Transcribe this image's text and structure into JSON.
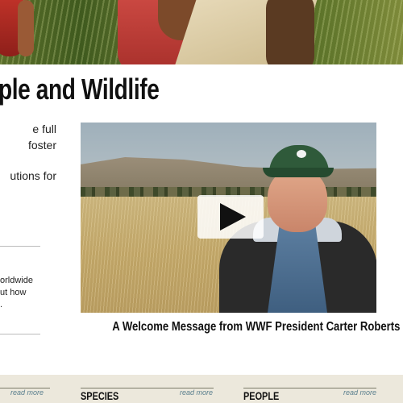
{
  "title": "ple and Wildlife",
  "intro_lines": [
    "e full",
    "foster",
    "",
    "utions for"
  ],
  "side_note_lines": [
    "orldwide",
    "ut how",
    "."
  ],
  "video": {
    "caption": "A Welcome Message from WWF President Carter Roberts",
    "play_icon": "play-icon"
  },
  "sections": [
    {
      "read_more": "read more",
      "label": ""
    },
    {
      "read_more": "read more",
      "label": "SPECIES"
    },
    {
      "read_more": "read more",
      "label": "PEOPLE"
    }
  ],
  "colors": {
    "link": "#5a7f8e",
    "strip_bg": "#ece8dc",
    "cap_green": "#2f5a3a"
  }
}
